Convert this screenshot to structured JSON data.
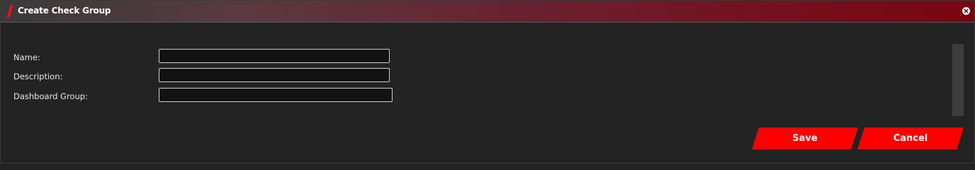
{
  "dialog": {
    "title": "Create Check Group",
    "close_icon": "close-icon",
    "accent_color": "#ff0000"
  },
  "form": {
    "fields": [
      {
        "label": "Name:",
        "value": "",
        "placeholder": ""
      },
      {
        "label": "Description:",
        "value": "",
        "placeholder": ""
      },
      {
        "label": "Dashboard Group:",
        "value": "",
        "placeholder": ""
      }
    ]
  },
  "actions": {
    "save_label": "Save",
    "cancel_label": "Cancel"
  }
}
